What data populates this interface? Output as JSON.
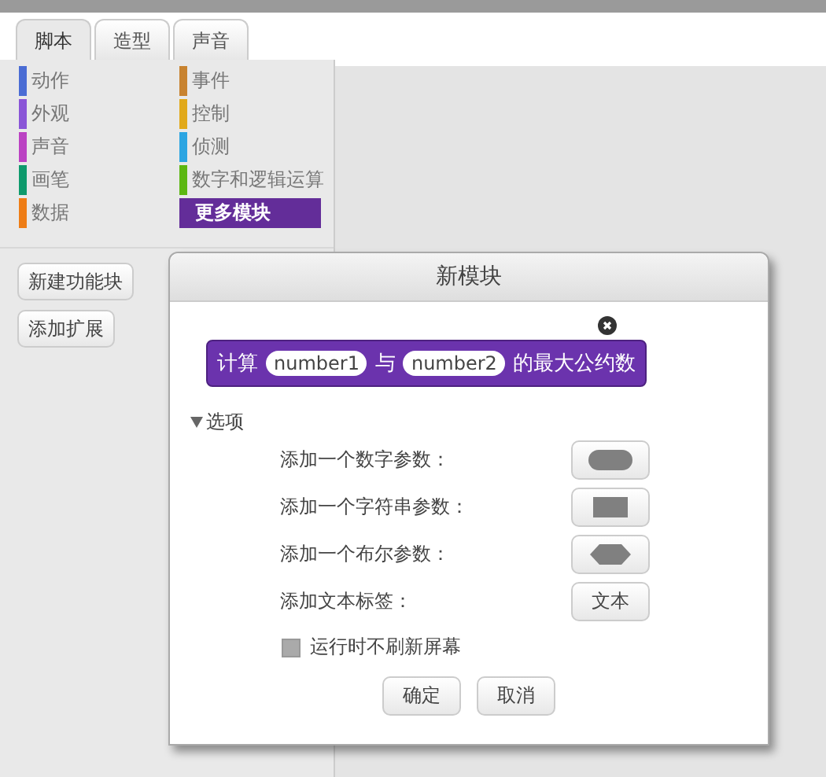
{
  "tabs": [
    {
      "label": "脚本",
      "selected": true
    },
    {
      "label": "造型",
      "selected": false
    },
    {
      "label": "声音",
      "selected": false
    }
  ],
  "categories": [
    {
      "label": "动作",
      "color": "#4a6cd4",
      "selected": false
    },
    {
      "label": "外观",
      "color": "#8a55d7",
      "selected": false
    },
    {
      "label": "声音",
      "color": "#bb42c3",
      "selected": false
    },
    {
      "label": "画笔",
      "color": "#0e9a6c",
      "selected": false
    },
    {
      "label": "数据",
      "color": "#ee7d16",
      "selected": false
    },
    {
      "label": "事件",
      "color": "#c88330",
      "selected": false
    },
    {
      "label": "控制",
      "color": "#e1a91a",
      "selected": false
    },
    {
      "label": "侦测",
      "color": "#2ca5e2",
      "selected": false
    },
    {
      "label": "数字和逻辑运算",
      "color": "#5cb712",
      "selected": false
    },
    {
      "label": "更多模块",
      "color": "#632d99",
      "selected": true
    }
  ],
  "palette_buttons": [
    "新建功能块",
    "添加扩展"
  ],
  "dialog": {
    "title": "新模块",
    "block": [
      {
        "kind": "label",
        "text": "计算"
      },
      {
        "kind": "input",
        "text": "number1"
      },
      {
        "kind": "label",
        "text": "与"
      },
      {
        "kind": "input",
        "text": "number2"
      },
      {
        "kind": "label",
        "text": "的最大公约数"
      }
    ],
    "options": {
      "label": "选项",
      "expanded": true,
      "rows": [
        {
          "kind": "number",
          "label": "添加一个数字参数："
        },
        {
          "kind": "string",
          "label": "添加一个字符串参数："
        },
        {
          "kind": "boolean",
          "label": "添加一个布尔参数："
        },
        {
          "kind": "text",
          "label": "添加文本标签：",
          "button": "文本"
        }
      ],
      "checkbox": {
        "label": "运行时不刷新屏幕",
        "checked": false
      }
    },
    "buttons": [
      "确定",
      "取消"
    ]
  }
}
